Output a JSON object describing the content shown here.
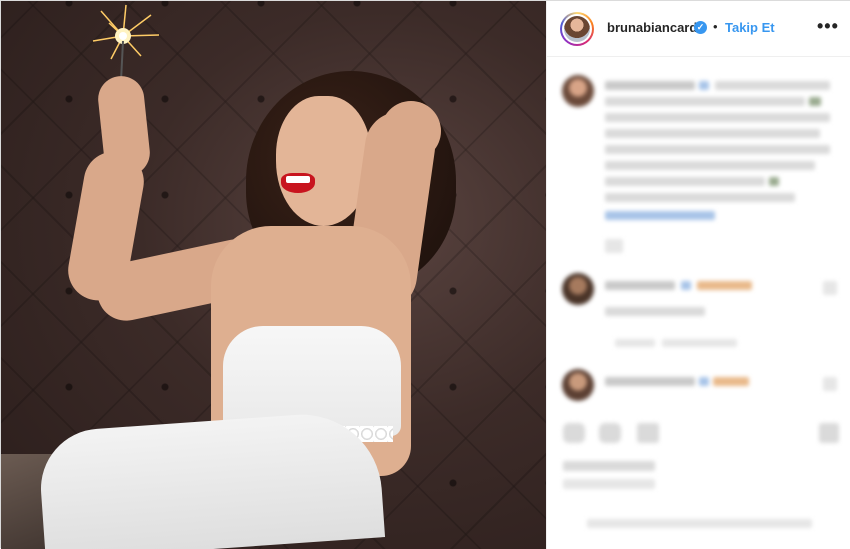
{
  "post": {
    "username": "brunabiancardi",
    "separator": "•",
    "follow_label": "Takip Et",
    "more_label": "•••"
  },
  "icons": {
    "verified": "verified-badge-icon",
    "more": "more-options-icon",
    "like": "heart-icon",
    "comment": "comment-icon",
    "share": "share-icon",
    "save": "bookmark-icon"
  },
  "colors": {
    "link_blue": "#3897f0",
    "text": "#262626",
    "border": "#dbdbdb"
  }
}
